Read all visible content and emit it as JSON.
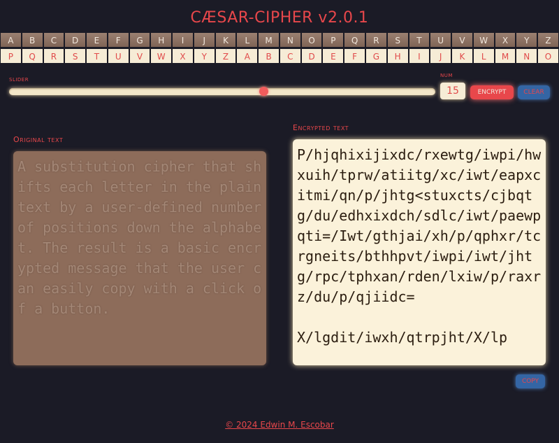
{
  "app": {
    "title": "CÆSAR-CIPHER v2.0.1"
  },
  "alphabet": {
    "plain": [
      "A",
      "B",
      "C",
      "D",
      "E",
      "F",
      "G",
      "H",
      "I",
      "J",
      "K",
      "L",
      "M",
      "N",
      "O",
      "P",
      "Q",
      "R",
      "S",
      "T",
      "U",
      "V",
      "W",
      "X",
      "Y",
      "Z"
    ],
    "cipher": [
      "P",
      "Q",
      "R",
      "S",
      "T",
      "U",
      "V",
      "W",
      "X",
      "Y",
      "Z",
      "A",
      "B",
      "C",
      "D",
      "E",
      "F",
      "G",
      "H",
      "I",
      "J",
      "K",
      "L",
      "M",
      "N",
      "O"
    ]
  },
  "controls": {
    "slider_label": "slider",
    "slider_value": 15,
    "slider_min": 0,
    "slider_max": 25,
    "num_label": "num",
    "num_value": "15",
    "encrypt_label": "ENCRYPT",
    "clear_label": "CLEAR",
    "copy_label": "COPY"
  },
  "original": {
    "label": "Original text",
    "text": "A substitution cipher that shifts each letter in the plaintext by a user-defined number of positions down the alphabet. The result is a basic encrypted message that the user can easily copy with a click of a button."
  },
  "encrypted": {
    "label": "Encrypted text",
    "text": "P/hjqhixijixdc/rxewtg/iwpi/hwxuih/tprw/atiitg/xc/iwt/eapxcitmi/qn/p/jhtg<stuxcts/cjbqtg/du/edhxixdch/sdlc/iwt/paewpqti=/Iwt/gthjai/xh/p/qphxr/tcrgneits/bthhpvt/iwpi/iwt/jhtg/rpc/tphxan/rden/lxiw/p/raxrz/du/p/qjiidc=\n\nX/lgdit/iwxh/qtrpjht/X/lp"
  },
  "footer": {
    "text": "© 2024 Edwin M. Escobar"
  },
  "colors": {
    "background": "#1b1b26",
    "accent": "#e8474b",
    "button_blue": "#3465a4"
  }
}
